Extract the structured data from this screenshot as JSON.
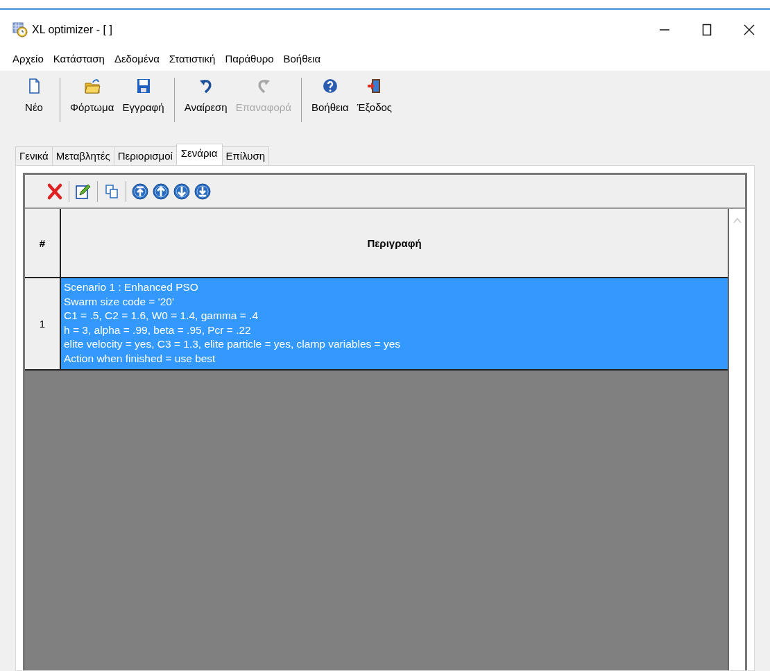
{
  "window": {
    "title": "XL optimizer - [ ]"
  },
  "menu": [
    "Αρχείο",
    "Κατάσταση",
    "Δεδομένα",
    "Στατιστική",
    "Παράθυρο",
    "Βοήθεια"
  ],
  "toolbar": {
    "groups": [
      [
        {
          "label": "Νέο",
          "disabled": false
        }
      ],
      [
        {
          "label": "Φόρτωμα",
          "disabled": false
        },
        {
          "label": "Εγγραφή",
          "disabled": false
        }
      ],
      [
        {
          "label": "Αναίρεση",
          "disabled": false
        },
        {
          "label": "Επαναφορά",
          "disabled": true
        }
      ],
      [
        {
          "label": "Βοήθεια",
          "disabled": false
        },
        {
          "label": "Έξοδος",
          "disabled": false
        }
      ]
    ]
  },
  "tabs": [
    {
      "label": "Γενικά",
      "selected": false
    },
    {
      "label": "Μεταβλητές",
      "selected": false
    },
    {
      "label": "Περιορισμοί",
      "selected": false
    },
    {
      "label": "Σενάρια",
      "selected": true
    },
    {
      "label": "Επίλυση",
      "selected": false
    }
  ],
  "table": {
    "columns": [
      "#",
      "Περιγραφή"
    ],
    "rows": [
      {
        "number": "1",
        "selected": true,
        "description": [
          "Scenario 1 : Enhanced PSO",
          "Swarm size code = '20'",
          "C1 = .5, C2 = 1.6, W0 = 1.4, gamma = .4",
          "h = 3, alpha = .99, beta = .95, Pcr = .22",
          "elite velocity = yes, C3 = 1.3, elite particle = yes, clamp variables = yes",
          "Action when finished = use best"
        ]
      }
    ]
  }
}
